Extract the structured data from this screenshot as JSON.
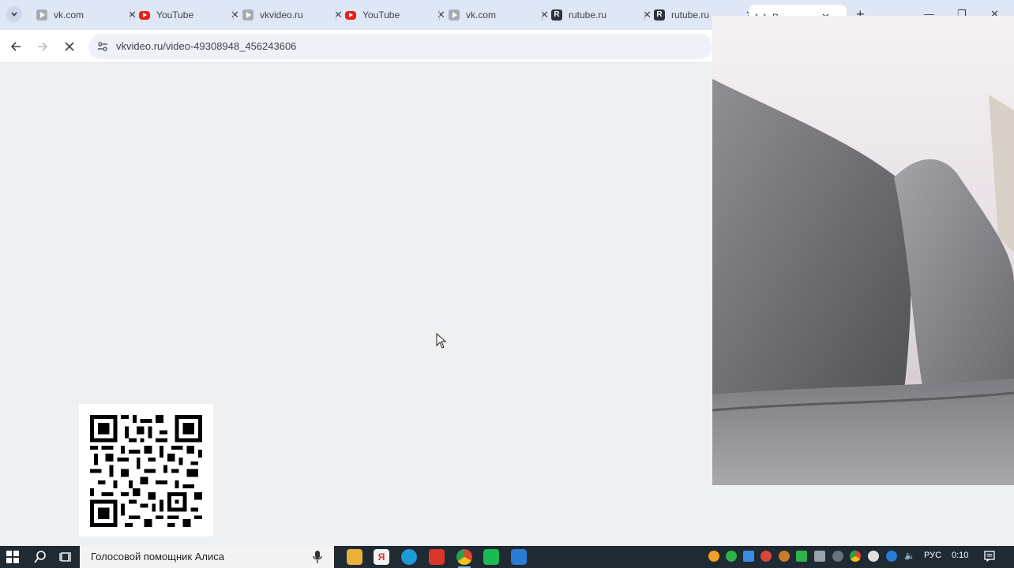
{
  "browser": {
    "tabs": [
      {
        "label": "vk.com",
        "favicon": "vk-video-icon"
      },
      {
        "label": "YouTube",
        "favicon": "youtube-icon"
      },
      {
        "label": "vkvideo.ru",
        "favicon": "vk-video-icon"
      },
      {
        "label": "YouTube",
        "favicon": "youtube-icon"
      },
      {
        "label": "vk.com",
        "favicon": "vk-video-icon"
      },
      {
        "label": "rutube.ru",
        "favicon": "rutube-icon"
      },
      {
        "label": "rutube.ru",
        "favicon": "rutube-icon"
      },
      {
        "label": "В...",
        "favicon": "loading-icon",
        "active": true
      }
    ],
    "tab_close_glyph": "✕",
    "new_tab_glyph": "+",
    "address_bar": {
      "url": "vkvideo.ru/video-49308948_456243606",
      "loading": true
    }
  },
  "overlay": {
    "qr_code": "qr-code-icon",
    "webcam": "webcam-feed"
  },
  "taskbar": {
    "search_text": "Голосовой помощник Алиса",
    "language": "РУС",
    "time": "0:10"
  },
  "colors": {
    "tabstrip": "#dfe6f5",
    "page_bg": "#eef0f2",
    "taskbar": "#1f2a33",
    "youtube_red": "#e62117"
  }
}
